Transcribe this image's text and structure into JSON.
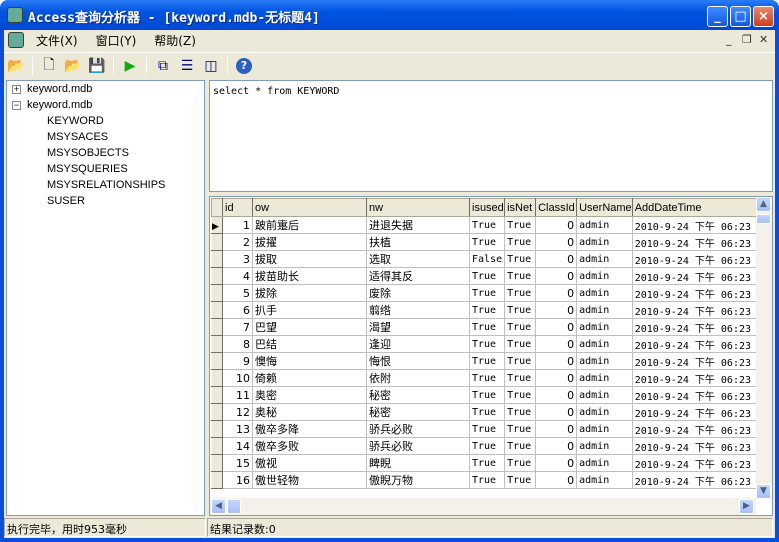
{
  "window": {
    "title": "Access查询分析器 - [keyword.mdb-无标题4]"
  },
  "menu": [
    {
      "label": "文件(X)"
    },
    {
      "label": "窗口(Y)"
    },
    {
      "label": "帮助(Z)"
    }
  ],
  "toolbar": [
    "connect-icon",
    "new-icon",
    "open-icon",
    "save-icon",
    "run-icon",
    "cascade-icon",
    "tile-horizontal-icon",
    "tile-vertical-icon",
    "help-icon"
  ],
  "tree": {
    "nodes": [
      {
        "label": "keyword.mdb",
        "expanded": false
      },
      {
        "label": "keyword.mdb",
        "expanded": true,
        "children": [
          "KEYWORD",
          "MSYSACES",
          "MSYSOBJECTS",
          "MSYSQUERIES",
          "MSYSRELATIONSHIPS",
          "SUSER"
        ]
      }
    ]
  },
  "sql": "select * from KEYWORD",
  "grid": {
    "columns": [
      "id",
      "ow",
      "nw",
      "isused",
      "isNet",
      "ClassId",
      "UserName",
      "AddDateTime"
    ],
    "rows": [
      [
        "1",
        "跛前疐后",
        "进退失据",
        "True",
        "True",
        "0",
        "admin",
        "2010-9-24 下午 06:23"
      ],
      [
        "2",
        "拔擢",
        "扶植",
        "True",
        "True",
        "0",
        "admin",
        "2010-9-24 下午 06:23"
      ],
      [
        "3",
        "拔取",
        "选取",
        "False",
        "True",
        "0",
        "admin",
        "2010-9-24 下午 06:23"
      ],
      [
        "4",
        "拔苗助长",
        "适得其反",
        "True",
        "True",
        "0",
        "admin",
        "2010-9-24 下午 06:23"
      ],
      [
        "5",
        "拔除",
        "废除",
        "True",
        "True",
        "0",
        "admin",
        "2010-9-24 下午 06:23"
      ],
      [
        "6",
        "扒手",
        "翦绺",
        "True",
        "True",
        "0",
        "admin",
        "2010-9-24 下午 06:23"
      ],
      [
        "7",
        "巴望",
        "渴望",
        "True",
        "True",
        "0",
        "admin",
        "2010-9-24 下午 06:23"
      ],
      [
        "8",
        "巴结",
        "逢迎",
        "True",
        "True",
        "0",
        "admin",
        "2010-9-24 下午 06:23"
      ],
      [
        "9",
        "懊悔",
        "悔恨",
        "True",
        "True",
        "0",
        "admin",
        "2010-9-24 下午 06:23"
      ],
      [
        "10",
        "倚赖",
        "依附",
        "True",
        "True",
        "0",
        "admin",
        "2010-9-24 下午 06:23"
      ],
      [
        "11",
        "奥密",
        "秘密",
        "True",
        "True",
        "0",
        "admin",
        "2010-9-24 下午 06:23"
      ],
      [
        "12",
        "奥秘",
        "秘密",
        "True",
        "True",
        "0",
        "admin",
        "2010-9-24 下午 06:23"
      ],
      [
        "13",
        "傲卒多降",
        "骄兵必败",
        "True",
        "True",
        "0",
        "admin",
        "2010-9-24 下午 06:23"
      ],
      [
        "14",
        "傲卒多败",
        "骄兵必败",
        "True",
        "True",
        "0",
        "admin",
        "2010-9-24 下午 06:23"
      ],
      [
        "15",
        "傲视",
        "睥睨",
        "True",
        "True",
        "0",
        "admin",
        "2010-9-24 下午 06:23"
      ],
      [
        "16",
        "傲世轻物",
        "傲睨万物",
        "True",
        "True",
        "0",
        "admin",
        "2010-9-24 下午 06:23"
      ]
    ]
  },
  "status": {
    "left": "执行完毕，用时953毫秒",
    "right": "结果记录数:0"
  }
}
